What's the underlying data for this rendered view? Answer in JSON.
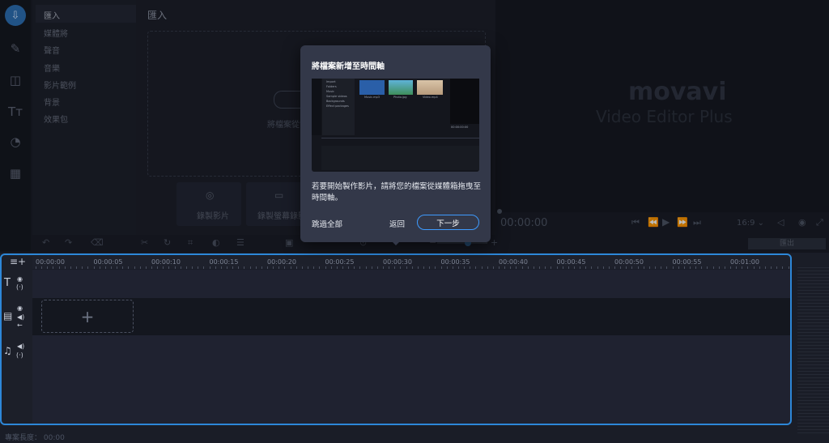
{
  "sidebar": {
    "categories": [
      "匯入",
      "媒體將",
      "聲音",
      "音樂",
      "影片範例",
      "背景",
      "效果包"
    ]
  },
  "import_panel": {
    "title": "匯入",
    "drop_text": "將檔案從電",
    "tile1_label": "錄製影片",
    "tile2_label": "錄製螢幕錄影"
  },
  "preview": {
    "logo": "movavi",
    "subtitle": "Video Editor Plus",
    "time": "00:00:00",
    "aspect": "16:9 ⌄",
    "export_label": "匯出"
  },
  "timeline": {
    "ticks": [
      "00:00:00",
      "00:00:05",
      "00:00:10",
      "00:00:15",
      "00:00:20",
      "00:00:25",
      "00:00:30",
      "00:00:35",
      "00:00:40",
      "00:00:45",
      "00:00:50",
      "00:00:55",
      "00:01:00"
    ],
    "add_clip": "+"
  },
  "status": {
    "text": "專案長度： 00:00"
  },
  "modal": {
    "title": "將檔案新增至時間軸",
    "body": "若要開始製作影片，請將您的檔案從媒體箱拖曳至時間軸。",
    "skip": "跳過全部",
    "back": "返回",
    "next": "下一步",
    "illustration": {
      "menu": [
        "Import",
        "Folders",
        "Music",
        "Sample videos",
        "Backgrounds",
        "Effect packages"
      ],
      "captions": [
        "Music.mp3",
        "Photo.jpg",
        "Video.mp4"
      ],
      "timecode": "00:00:00:00"
    }
  },
  "colors": {
    "accent": "#2d87d8",
    "modal_bg": "#333849",
    "button_border": "#3e9bff"
  }
}
